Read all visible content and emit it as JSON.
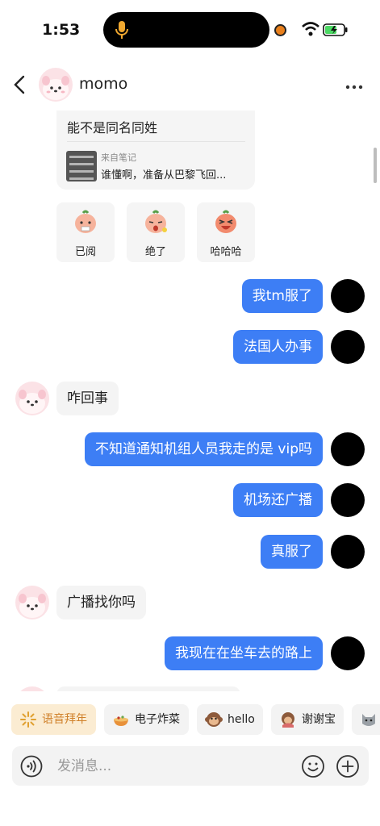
{
  "status_bar": {
    "time": "1:53"
  },
  "header": {
    "name": "momo"
  },
  "note_card": {
    "title": "能不是同名同姓",
    "from_label": "来自笔记",
    "note_text": "谁懂啊，准备从巴黎飞回..."
  },
  "stickers": [
    {
      "label": "已阅"
    },
    {
      "label": "绝了"
    },
    {
      "label": "哈哈哈"
    }
  ],
  "messages": [
    {
      "sender": "me",
      "text": "我tm服了"
    },
    {
      "sender": "me",
      "text": "法国人办事"
    },
    {
      "sender": "them",
      "text": "咋回事"
    },
    {
      "sender": "me",
      "text": "不知道通知机组人员我走的是 vip吗"
    },
    {
      "sender": "me",
      "text": "机场还广播"
    },
    {
      "sender": "me",
      "text": "真服了"
    },
    {
      "sender": "them",
      "text": "广播找你吗"
    },
    {
      "sender": "me",
      "text": "我现在在坐车去的路上"
    }
  ],
  "quick_replies": [
    {
      "label": "语音拜年",
      "icon": "sparkle-icon"
    },
    {
      "label": "电子炸菜",
      "icon": "dish-icon"
    },
    {
      "label": "hello",
      "icon": "monkey-icon"
    },
    {
      "label": "谢谢宝",
      "icon": "monkey-thanks-icon"
    },
    {
      "label": "",
      "icon": "cat-icon"
    }
  ],
  "input": {
    "placeholder": "发消息..."
  },
  "colors": {
    "accent": "#3d7ef5",
    "bubble_other": "#f4f4f4",
    "voice_chip": "#fbecd2"
  }
}
